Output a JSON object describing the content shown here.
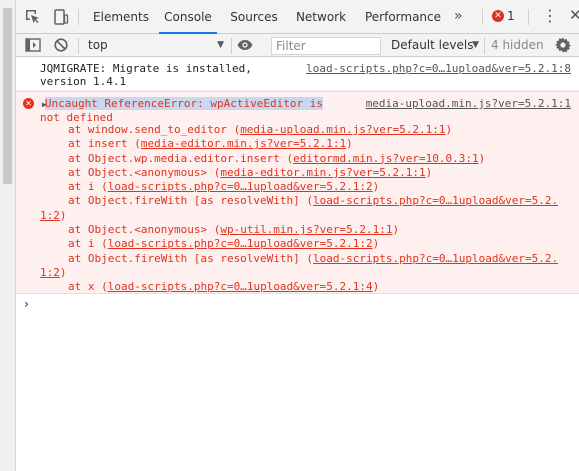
{
  "tabs": [
    {
      "label": "Elements"
    },
    {
      "label": "Console"
    },
    {
      "label": "Sources"
    },
    {
      "label": "Network"
    },
    {
      "label": "Performance"
    }
  ],
  "more_tabs": "»",
  "error_count": "1",
  "toolbar": {
    "context": "top",
    "filter_placeholder": "Filter",
    "levels": "Default levels",
    "hidden": "4 hidden"
  },
  "log": {
    "text": "JQMIGRATE: Migrate is installed,\nversion 1.4.1",
    "source": "load-scripts.php?c=0…1upload&ver=5.2.1:8"
  },
  "error": {
    "message_head": "Uncaught ReferenceError: wpActiveEditor is",
    "message_tail": "not defined",
    "source": "media-upload.min.js?ver=5.2.1:1",
    "stack": [
      {
        "at": "at window.send_to_editor (",
        "link": "media-upload.min.js?ver=5.2.1:1",
        "close": ")"
      },
      {
        "at": "at insert (",
        "link": "media-editor.min.js?ver=5.2.1:1",
        "close": ")"
      },
      {
        "at": "at Object.wp.media.editor.insert (",
        "link": "editormd.min.js?ver=10.0.3:1",
        "close": ")"
      },
      {
        "at": "at Object.<anonymous> (",
        "link": "media-editor.min.js?ver=5.2.1:1",
        "close": ")"
      },
      {
        "at": "at i (",
        "link": "load-scripts.php?c=0…1upload&ver=5.2.1:2",
        "close": ")"
      },
      {
        "at": "at Object.fireWith [as resolveWith] (",
        "link": "load-scripts.php?c=0…1upload&ver=5.2.",
        "close": ""
      },
      {
        "at": "",
        "link": "1:2",
        "close": ")",
        "cont": true
      },
      {
        "at": "at Object.<anonymous> (",
        "link": "wp-util.min.js?ver=5.2.1:1",
        "close": ")"
      },
      {
        "at": "at i (",
        "link": "load-scripts.php?c=0…1upload&ver=5.2.1:2",
        "close": ")"
      },
      {
        "at": "at Object.fireWith [as resolveWith] (",
        "link": "load-scripts.php?c=0…1upload&ver=5.2.",
        "close": ""
      },
      {
        "at": "",
        "link": "1:2",
        "close": ")",
        "cont": true
      },
      {
        "at": "at x (",
        "link": "load-scripts.php?c=0…1upload&ver=5.2.1:4",
        "close": ")"
      }
    ]
  },
  "prompt": "›"
}
